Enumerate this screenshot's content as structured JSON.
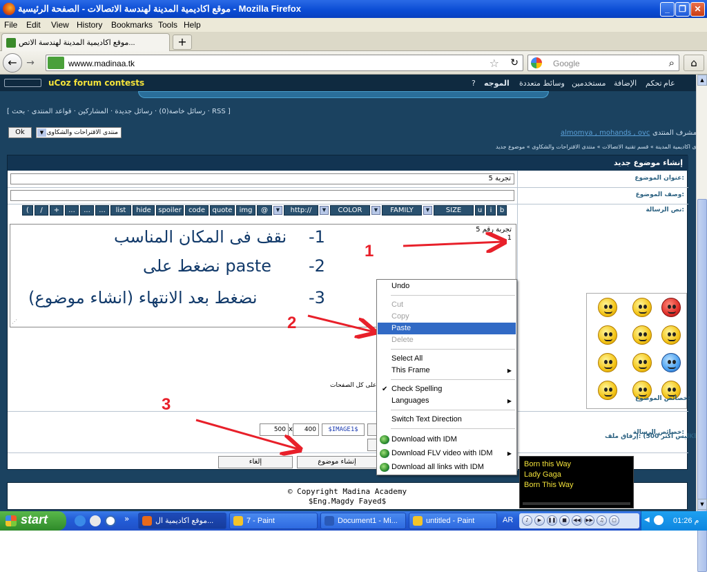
{
  "window": {
    "title": "موقع اكاديمية المدينة لهندسة الاتصالات - الصفحة الرئيسية - Mozilla Firefox"
  },
  "menu": [
    "File",
    "Edit",
    "View",
    "History",
    "Bookmarks",
    "Tools",
    "Help"
  ],
  "tab": {
    "label": "موقع اكاديمية المدينة لهندسة الاتص..."
  },
  "nav": {
    "url": "wwww.madinaa.tk",
    "search_placeholder": "Google"
  },
  "site": {
    "contest": "uCoz forum contests",
    "topnav": [
      "عام",
      "تحكم",
      "الإضافة",
      "مستخدمين",
      "وسائط متعددة",
      "الموجه",
      "?"
    ],
    "links": "[ رسائل خاصة(0) · رسائل جديدة · المشاركين · قواعد المنتدى · بحث · RSS ]",
    "moderators_label": "مشرف المنتدى:",
    "moderators": "almomya , mohands , ovc",
    "breadcrumb": "منتدى اكاديمية المدينة » قسم تقنية الاتصالات » منتدى الاقتراحات والشكاوى » موضوع جديد",
    "ok": "Ok",
    "forum_select": "منتدى الاقتراحات والشكاوى"
  },
  "form": {
    "header": "إنشاء موضوع جديد",
    "title_label": "عنوان الموضوع:",
    "title_value": "تجربة 5",
    "desc_label": "وصف الموضوع:",
    "msg_label": "نص الرسالة:",
    "msg_props_label": "خصائص الرسالة:",
    "topic_props_label": "خصائص الموضوع:",
    "topic_props_text": "على كل الصفحات)",
    "attach_label": "إرفاق ملف: (ليس أكثر 500Kb)",
    "img_w": "500",
    "img_x": "x",
    "img_h": "400",
    "img_tag": "$IMAGE1$",
    "create_btn": "إنشاء موضوع",
    "cancel_btn": "إلغاء"
  },
  "toolbar": [
    "b",
    "i",
    "u",
    "SIZE",
    "FAMILY",
    "COLOR",
    "http://",
    "@",
    "img",
    "quote",
    "code",
    "spoiler",
    "hide",
    "list",
    "...",
    "...",
    "...",
    "+",
    "/",
    "("
  ],
  "editor": {
    "first_line": "تجربة رقم 5",
    "second_line": "1",
    "step1_num": "-1",
    "step1": "نقف فى المكان المناسب",
    "step2_num": "-2",
    "step2": "نضغط على paste",
    "step3_num": "-3",
    "step3": "نضغط بعد الانتهاء (انشاء موضوع)"
  },
  "annotations": [
    "1",
    "2",
    "3"
  ],
  "context_menu": [
    {
      "label": "Undo",
      "disabled": false
    },
    {
      "label": "Cut",
      "disabled": true
    },
    {
      "label": "Copy",
      "disabled": true
    },
    {
      "label": "Paste",
      "disabled": false,
      "selected": true
    },
    {
      "label": "Delete",
      "disabled": true
    },
    {
      "label": "Select All",
      "disabled": false
    },
    {
      "label": "This Frame",
      "disabled": false,
      "submenu": true
    },
    {
      "label": "Check Spelling",
      "disabled": false,
      "checked": true
    },
    {
      "label": "Languages",
      "disabled": false,
      "submenu": true
    },
    {
      "label": "Switch Text Direction",
      "disabled": false
    },
    {
      "label": "Download with IDM",
      "disabled": false,
      "icon": "idm-icon"
    },
    {
      "label": "Download FLV video with IDM",
      "disabled": false,
      "icon": "idm-icon",
      "submenu": true
    },
    {
      "label": "Download all links with IDM",
      "disabled": false,
      "icon": "idm-icon"
    }
  ],
  "footer": {
    "line1": "© Copyright Madina Academy",
    "line2": "$Eng.Magdy Fayed$"
  },
  "music": {
    "line1": "Born this Way",
    "line2": "Lady Gaga",
    "line3": "Born This Way"
  },
  "taskbar": {
    "start": "start",
    "tasks": [
      {
        "label": "موقع اكاديمية ال...",
        "active": true
      },
      {
        "label": "7 - Paint",
        "active": false
      },
      {
        "label": "Document1 - Mi...",
        "active": false
      },
      {
        "label": "untitled - Paint",
        "active": false
      }
    ],
    "lang": "AR",
    "clock": "01:26 م"
  },
  "colors": {
    "accent": "#316ac5",
    "annotation": "#e8202a",
    "page_bg": "#1b4260",
    "link": "#5aa0d8"
  }
}
